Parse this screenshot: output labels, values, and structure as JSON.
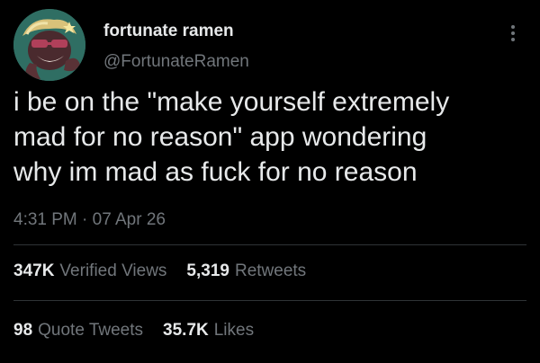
{
  "user": {
    "display_name": "fortunate ramen",
    "handle": "@FortunateRamen"
  },
  "tweet": {
    "text": "i be on the \"make yourself extremely\nmad for no reason\" app wondering\nwhy im mad as fuck for no reason",
    "timestamp": "4:31 PM · 07 Apr 26"
  },
  "stats": {
    "views": {
      "count": "347K",
      "label": "Verified Views"
    },
    "retweets": {
      "count": "5,319",
      "label": "Retweets"
    },
    "quotes": {
      "count": "98",
      "label": "Quote Tweets"
    },
    "likes": {
      "count": "35.7K",
      "label": "Likes"
    }
  },
  "icons": {
    "more": "more-vertical-icon"
  },
  "colors": {
    "background": "#000000",
    "primary_text": "#e7e9ea",
    "secondary_text": "#71767b",
    "divider": "#2f3336",
    "avatar_bg": "#2f6e63"
  }
}
